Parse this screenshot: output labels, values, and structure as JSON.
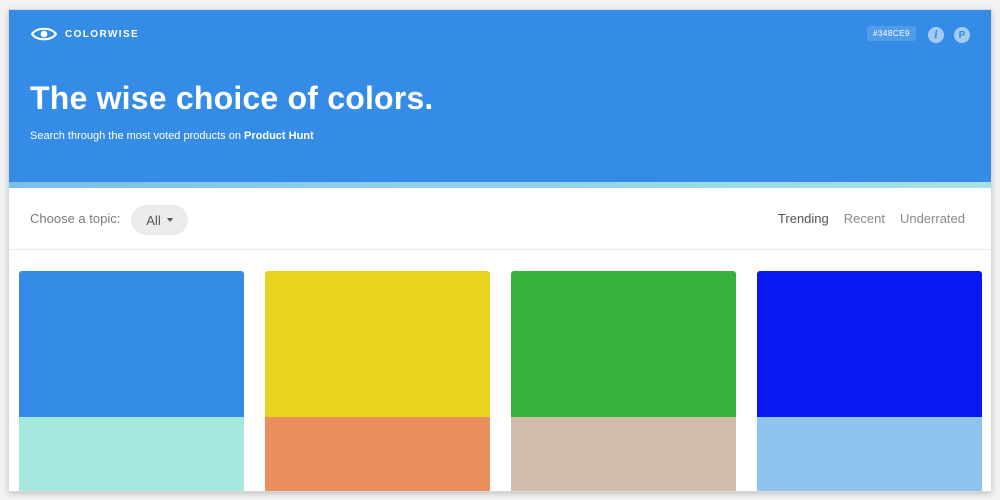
{
  "brand": {
    "name": "COLORWISE",
    "icon": "eye-icon",
    "logo_color": "#ffffff"
  },
  "header": {
    "hex_code": "#348CE9",
    "info_label": "i",
    "profile_label": "P",
    "background_color": "#348ce6"
  },
  "hero": {
    "headline": "The wise choice of colors.",
    "subline_prefix": "Search through the most voted products on",
    "subline_link": "Product Hunt"
  },
  "filter": {
    "topic_label": "Choose a topic:",
    "topic_value": "All",
    "sort_tabs": [
      {
        "label": "Trending",
        "active": true
      },
      {
        "label": "Recent",
        "active": false
      },
      {
        "label": "Underrated",
        "active": false
      }
    ]
  },
  "cards": [
    {
      "top_color": "#348ce6",
      "bottom_color": "#a5e8dd"
    },
    {
      "top_color": "#e8d41e",
      "bottom_color": "#ec8f5f"
    },
    {
      "top_color": "#35b33c",
      "bottom_color": "#d4bcab"
    },
    {
      "top_color": "#0a18f4",
      "bottom_color": "#8fc4ee"
    }
  ]
}
